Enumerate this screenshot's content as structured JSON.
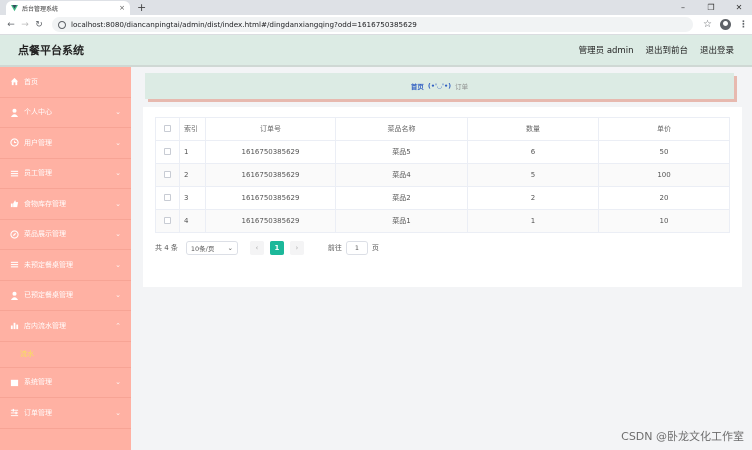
{
  "browser": {
    "tab_title": "后台管理系统",
    "tab_close": "×",
    "new_tab": "+",
    "url": "localhost:8080/diancanpingtai/admin/dist/index.html#/dingdanxiangqing?odd=1616750385629",
    "win_min": "–",
    "win_restore": "❐",
    "win_close": "✕",
    "back": "←",
    "forward": "→",
    "reload": "↻",
    "star": "☆",
    "kebab": "⋮"
  },
  "header": {
    "title": "点餐平台系统",
    "admin_label": "管理员 admin",
    "back_front": "退出到前台",
    "logout": "退出登录"
  },
  "sidebar": {
    "items": [
      {
        "label": "首页",
        "icon": "home-icon"
      },
      {
        "label": "个人中心",
        "icon": "user-icon"
      },
      {
        "label": "用户管理",
        "icon": "clock-icon"
      },
      {
        "label": "员工管理",
        "icon": "list-icon"
      },
      {
        "label": "食物库存管理",
        "icon": "thumb-icon"
      },
      {
        "label": "菜品展示管理",
        "icon": "compass-icon"
      },
      {
        "label": "未预定餐桌管理",
        "icon": "list-icon"
      },
      {
        "label": "已预定餐桌管理",
        "icon": "user-icon"
      },
      {
        "label": "店内流水管理",
        "icon": "bar-chart-icon"
      }
    ],
    "submenu_label": "流水",
    "bottom_items": [
      {
        "label": "系统管理",
        "icon": "box-icon"
      },
      {
        "label": "订单管理",
        "icon": "sliders-icon"
      }
    ]
  },
  "breadcrumb": {
    "home": "首页",
    "face": "(•'◡'•)",
    "current": "订单"
  },
  "table": {
    "headers": [
      "索引",
      "订单号",
      "菜品名称",
      "数量",
      "单价"
    ],
    "rows": [
      {
        "index": "1",
        "order": "1616750385629",
        "dish": "菜品5",
        "qty": "6",
        "price": "50"
      },
      {
        "index": "2",
        "order": "1616750385629",
        "dish": "菜品4",
        "qty": "5",
        "price": "100"
      },
      {
        "index": "3",
        "order": "1616750385629",
        "dish": "菜品2",
        "qty": "2",
        "price": "20"
      },
      {
        "index": "4",
        "order": "1616750385629",
        "dish": "菜品1",
        "qty": "1",
        "price": "10"
      }
    ]
  },
  "pagination": {
    "total": "共 4 条",
    "page_size": "10条/页",
    "prev": "‹",
    "current": "1",
    "next": "›",
    "goto_prefix": "前往",
    "goto_value": "1",
    "goto_suffix": "页"
  },
  "watermark": "CSDN @卧龙文化工作室",
  "colors": {
    "sidebar_bg": "#ffb1a3",
    "header_bg": "#dcebe4",
    "accent": "#1cb89a",
    "submenu_text": "#f7e15a"
  }
}
